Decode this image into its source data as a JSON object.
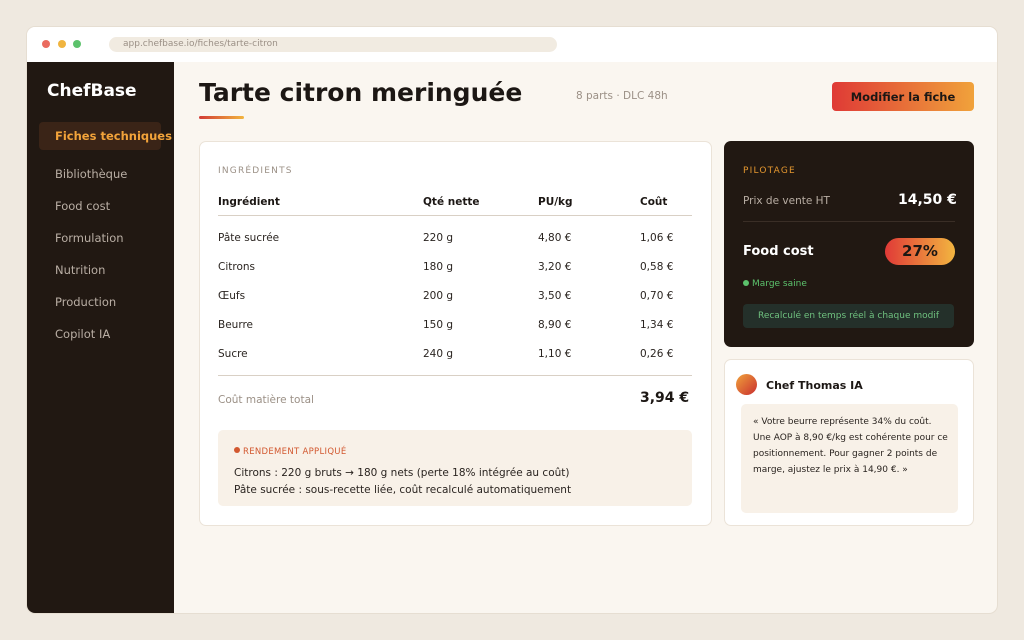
{
  "browser": {
    "url": "app.chefbase.io/fiches/tarte-citron"
  },
  "sidebar": {
    "brand": "ChefBase",
    "items": [
      {
        "label": "Fiches techniques",
        "active": true
      },
      {
        "label": "Bibliothèque",
        "active": false
      },
      {
        "label": "Food cost",
        "active": false
      },
      {
        "label": "Formulation",
        "active": false
      },
      {
        "label": "Nutrition",
        "active": false
      },
      {
        "label": "Production",
        "active": false
      },
      {
        "label": "Copilot IA",
        "active": false
      }
    ]
  },
  "header": {
    "title": "Tarte citron meringuée",
    "meta": "8 parts · DLC 48h",
    "edit_button": "Modifier la fiche"
  },
  "ingredients": {
    "section_label": "INGRÉDIENTS",
    "columns": [
      "Ingrédient",
      "Qté nette",
      "PU/kg",
      "Coût"
    ],
    "rows": [
      {
        "name": "Pâte sucrée",
        "qty": "220 g",
        "unit_price": "4,80 €",
        "cost": "1,06 €"
      },
      {
        "name": "Citrons",
        "qty": "180 g",
        "unit_price": "3,20 €",
        "cost": "0,58 €"
      },
      {
        "name": "Œufs",
        "qty": "200 g",
        "unit_price": "3,50 €",
        "cost": "0,70 €"
      },
      {
        "name": "Beurre",
        "qty": "150 g",
        "unit_price": "8,90 €",
        "cost": "1,34 €"
      },
      {
        "name": "Sucre",
        "qty": "240 g",
        "unit_price": "1,10 €",
        "cost": "0,26 €"
      }
    ],
    "total_label": "Coût matière total",
    "total_value": "3,94 €"
  },
  "yield": {
    "title": "RENDEMENT APPLIQUÉ",
    "lines": [
      "Citrons : 220 g bruts → 180 g nets (perte 18% intégrée au coût)",
      "Pâte sucrée : sous-recette liée, coût recalculé automatiquement"
    ]
  },
  "pilotage": {
    "label": "PILOTAGE",
    "price_label": "Prix de vente HT",
    "price_value": "14,50 €",
    "food_cost_label": "Food cost",
    "food_cost_value": "27%",
    "status": "Marge saine",
    "note": "Recalculé en temps réel à chaque modif"
  },
  "assistant": {
    "name": "Chef Thomas IA",
    "message": "« Votre beurre représente 34% du coût. Une AOP à 8,90 €/kg est cohérente pour ce positionnement. Pour gagner 2 points de marge, ajustez le prix à 14,90 €. »"
  },
  "colors": {
    "accent_red": "#df3a36",
    "accent_orange": "#f0a23b",
    "sidebar_bg": "#211812",
    "status_green": "#5cc26c"
  }
}
